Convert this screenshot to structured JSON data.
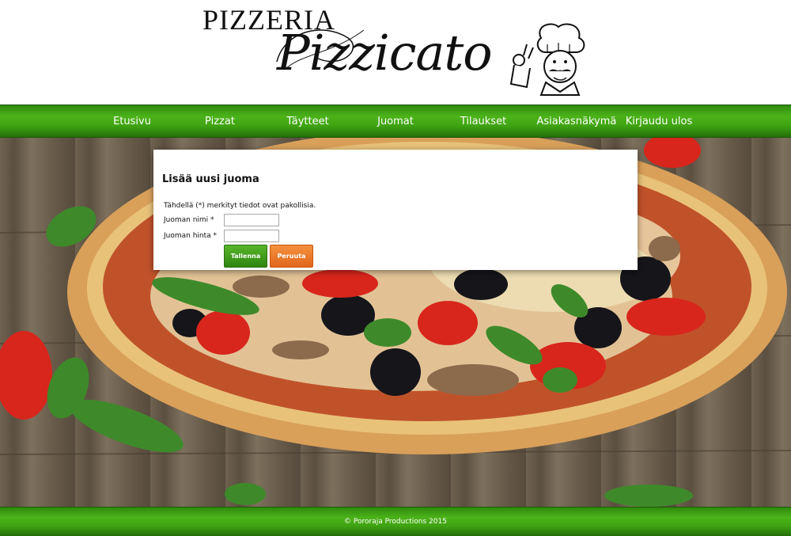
{
  "header": {
    "logo_line1": "PIZZERIA",
    "logo_line2": "Pizzicato"
  },
  "nav": {
    "items": [
      {
        "label": "Etusivu"
      },
      {
        "label": "Pizzat"
      },
      {
        "label": "Täytteet"
      },
      {
        "label": "Juomat"
      },
      {
        "label": "Tilaukset"
      },
      {
        "label": "Asiakasnäkymä"
      },
      {
        "label": "Kirjaudu ulos"
      }
    ]
  },
  "form": {
    "title": "Lisää uusi juoma",
    "required_note": "Tähdellä (*) merkityt tiedot ovat pakollisia.",
    "name_label": "Juoman nimi *",
    "name_value": "",
    "price_label": "Juoman hinta *",
    "price_value": "",
    "save_label": "Tallenna",
    "cancel_label": "Peruuta"
  },
  "footer": {
    "text": "© Pororaja Productions 2015"
  },
  "colors": {
    "nav_green": "#3fa312",
    "save_green": "#2f8510",
    "cancel_orange": "#e1661b"
  }
}
